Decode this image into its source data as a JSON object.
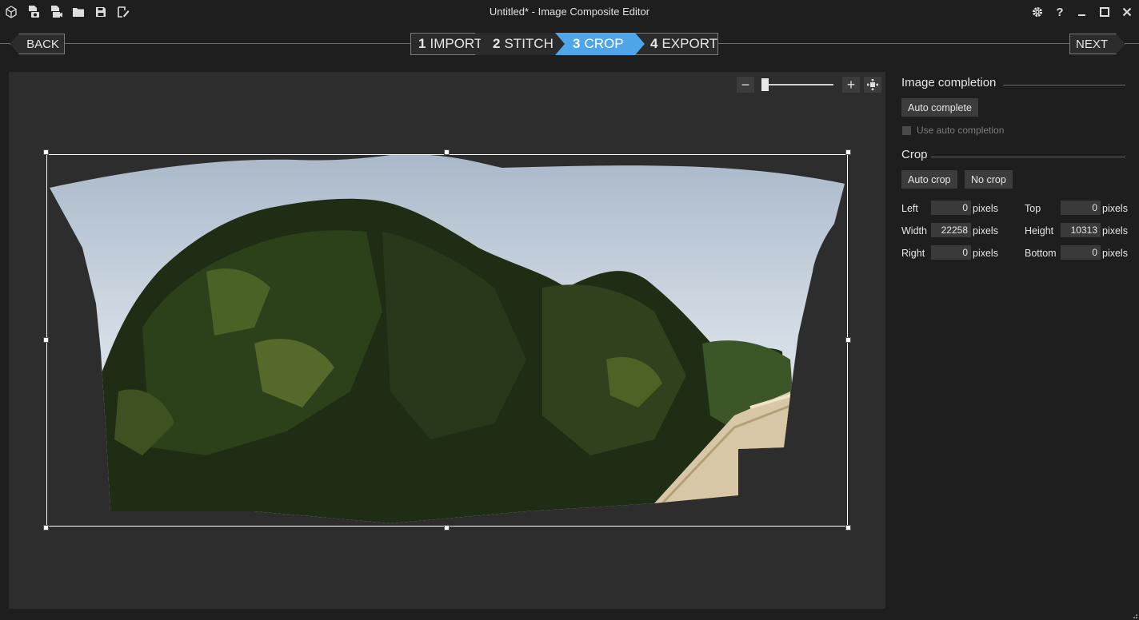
{
  "window": {
    "title": "Untitled* - Image Composite Editor"
  },
  "toolbar_icons": [
    "app-cube-icon",
    "new-panorama-from-images-icon",
    "new-panorama-from-video-icon",
    "open-folder-icon",
    "save-icon",
    "export-icon"
  ],
  "window_controls": [
    "settings-icon",
    "help-icon",
    "minimize-icon",
    "maximize-icon",
    "close-icon"
  ],
  "nav": {
    "back_label": "BACK",
    "next_label": "NEXT",
    "steps": [
      {
        "num": "1",
        "label": "IMPORT"
      },
      {
        "num": "2",
        "label": "STITCH"
      },
      {
        "num": "3",
        "label": "CROP"
      },
      {
        "num": "4",
        "label": "EXPORT"
      }
    ],
    "active_step": 3,
    "active_color": "#4ea6e8"
  },
  "zoom": {
    "minus": "−",
    "plus": "+",
    "level_fraction": 0.02
  },
  "image_completion": {
    "heading": "Image completion",
    "auto_complete_label": "Auto complete",
    "use_auto_completion_label": "Use auto completion",
    "use_auto_completion_checked": false
  },
  "crop": {
    "heading": "Crop",
    "auto_crop_label": "Auto crop",
    "no_crop_label": "No crop",
    "unit": "pixels",
    "fields": {
      "left": {
        "label": "Left",
        "value": "0"
      },
      "top": {
        "label": "Top",
        "value": "0"
      },
      "width": {
        "label": "Width",
        "value": "22258"
      },
      "height": {
        "label": "Height",
        "value": "10313"
      },
      "right": {
        "label": "Right",
        "value": "0"
      },
      "bottom": {
        "label": "Bottom",
        "value": "0"
      }
    }
  }
}
